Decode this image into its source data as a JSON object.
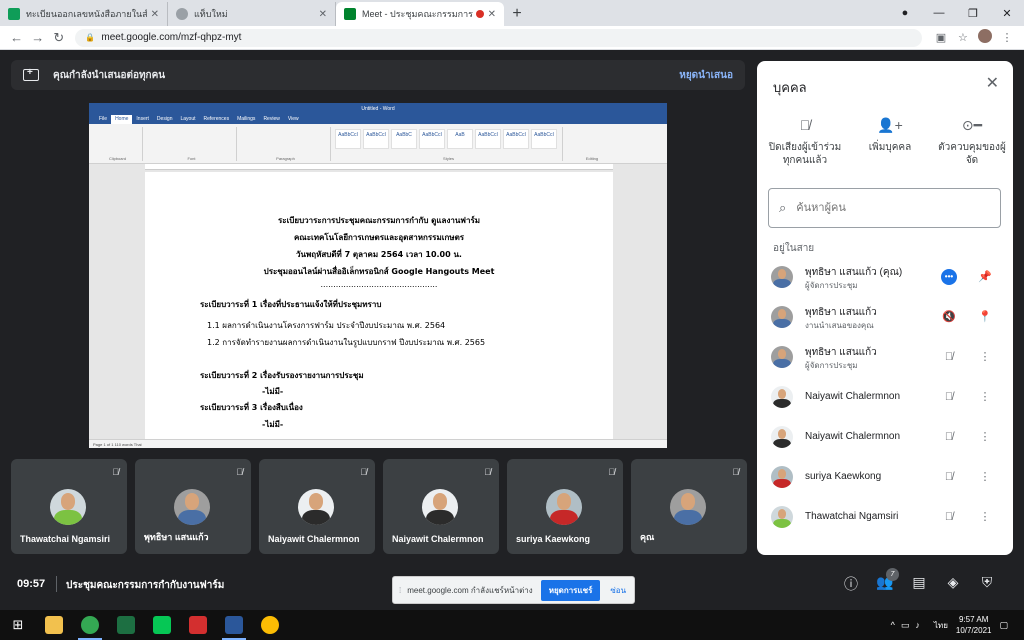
{
  "browser": {
    "tabs": [
      {
        "label": "ทะเบียนออกเลขหนังสือภายในสำนักงาน",
        "color": "#0f9d58"
      },
      {
        "label": "แท็บใหม่",
        "color": "#5f6368"
      },
      {
        "label": "Meet - ประชุมคณะกรรมการกำกับ",
        "color": "#00832d"
      }
    ],
    "url": "meet.google.com/mzf-qhpz-myt"
  },
  "presenting": {
    "message": "คุณกำลังนำเสนอต่อทุกคน",
    "stop_label": "หยุดนำเสนอ"
  },
  "document": {
    "window_title": "Untitled - Word",
    "menu": [
      "File",
      "Home",
      "Insert",
      "Design",
      "Layout",
      "References",
      "Mailings",
      "Review",
      "View"
    ],
    "styles": [
      "AaBbCcI",
      "AaBbCcI",
      "AaBbC",
      "AaBbCcI",
      "AaB",
      "AaBbCcI",
      "AaBbCcI",
      "AaBbCcI"
    ],
    "groups": [
      "Clipboard",
      "Font",
      "Paragraph",
      "Styles",
      "Editing"
    ],
    "status": "Page 1 of 1    110 words    Thai",
    "lines": {
      "l1": "ระเบียบวาระการประชุมคณะกรรมการกำกับ ดูแลงานฟาร์ม",
      "l2": "คณะเทคโนโลยีการเกษตรและอุตสาหกรรมเกษตร",
      "l3": "วันพฤหัสบดีที่ 7 ตุลาคม 2564 เวลา 10.00 น.",
      "l4": "ประชุมออนไลน์ผ่านสื่ออิเล็กทรอนิกส์ Google  Hangouts Meet",
      "l5": "..............................................",
      "l6": "ระเบียบวาระที่ 1 เรื่องที่ประธานแจ้งให้ที่ประชุมทราบ",
      "l7": "1.1 ผลการดำเนินงานโครงการฟาร์ม  ประจำปีงบประมาณ พ.ศ. 2564",
      "l8": "1.2 การจัดทำรายงานผลการดำเนินงานในรูปแบบกราฟ  ปีงบประมาณ พ.ศ. 2565",
      "l9": "ระเบียบวาระที่ 2  เรื่องรับรองรายงานการประชุม",
      "l10": "-ไม่มี-",
      "l11": "ระเบียบวาระที่ 3 เรื่องสืบเนื่อง",
      "l12": "-ไม่มี-"
    }
  },
  "tiles": [
    {
      "name": "Thawatchai Ngamsiri",
      "shirt": "#7cc242"
    },
    {
      "name": "พุทธิษา แสนแก้ว",
      "shirt": "#4a6fa5"
    },
    {
      "name": "Naiyawit Chalermnon",
      "shirt": "#2b2b2b"
    },
    {
      "name": "Naiyawit Chalermnon",
      "shirt": "#2b2b2b"
    },
    {
      "name": "suriya Kaewkong",
      "shirt": "#c62828"
    },
    {
      "name": "คุณ",
      "shirt": "#4a6fa5"
    }
  ],
  "bottom": {
    "time": "09:57",
    "meeting_title": "ประชุมคณะกรรมการกำกับงานฟาร์ม",
    "people_count": "7"
  },
  "share_notice": {
    "text": "meet.google.com กำลังแชร์หน้าต่าง",
    "stop_label": "หยุดการแชร์",
    "hide_label": "ซ่อน"
  },
  "people_panel": {
    "title": "บุคคล",
    "actions": {
      "mute_all": "ปิดเสียงผู้เข้าร่วมทุกคนแล้ว",
      "add_people": "เพิ่มบุคคล",
      "host_controls": "ตัวควบคุมของผู้จัด"
    },
    "search_placeholder": "ค้นหาผู้คน",
    "section": "อยู่ในสาย",
    "participants": [
      {
        "name": "พุทธิษา แสนแก้ว (คุณ)",
        "role": "ผู้จัดการประชุม",
        "shirt": "#4a6fa5"
      },
      {
        "name": "พุทธิษา แสนแก้ว",
        "role": "งานนำเสนอของคุณ",
        "shirt": "#4a6fa5"
      },
      {
        "name": "พุทธิษา แสนแก้ว",
        "role": "ผู้จัดการประชุม",
        "shirt": "#4a6fa5"
      },
      {
        "name": "Naiyawit Chalermnon",
        "role": "",
        "shirt": "#2b2b2b"
      },
      {
        "name": "Naiyawit Chalermnon",
        "role": "",
        "shirt": "#2b2b2b"
      },
      {
        "name": "suriya Kaewkong",
        "role": "",
        "shirt": "#c62828"
      },
      {
        "name": "Thawatchai Ngamsiri",
        "role": "",
        "shirt": "#7cc242"
      }
    ]
  },
  "taskbar": {
    "apps": [
      {
        "name": "file-explorer",
        "color": "#f2c14e"
      },
      {
        "name": "chrome",
        "color": "#34a853"
      },
      {
        "name": "excel",
        "color": "#1d6f42"
      },
      {
        "name": "line",
        "color": "#06c755"
      },
      {
        "name": "acrobat",
        "color": "#d32f2f"
      },
      {
        "name": "word",
        "color": "#2b579a"
      },
      {
        "name": "chrome-2",
        "color": "#fbbc04"
      }
    ],
    "language": "ไทย",
    "clock_time": "9:57 AM",
    "clock_date": "10/7/2021"
  },
  "colors": {
    "meet_bg": "#202124",
    "accent": "#1a73e8",
    "link": "#8ab4f8"
  }
}
